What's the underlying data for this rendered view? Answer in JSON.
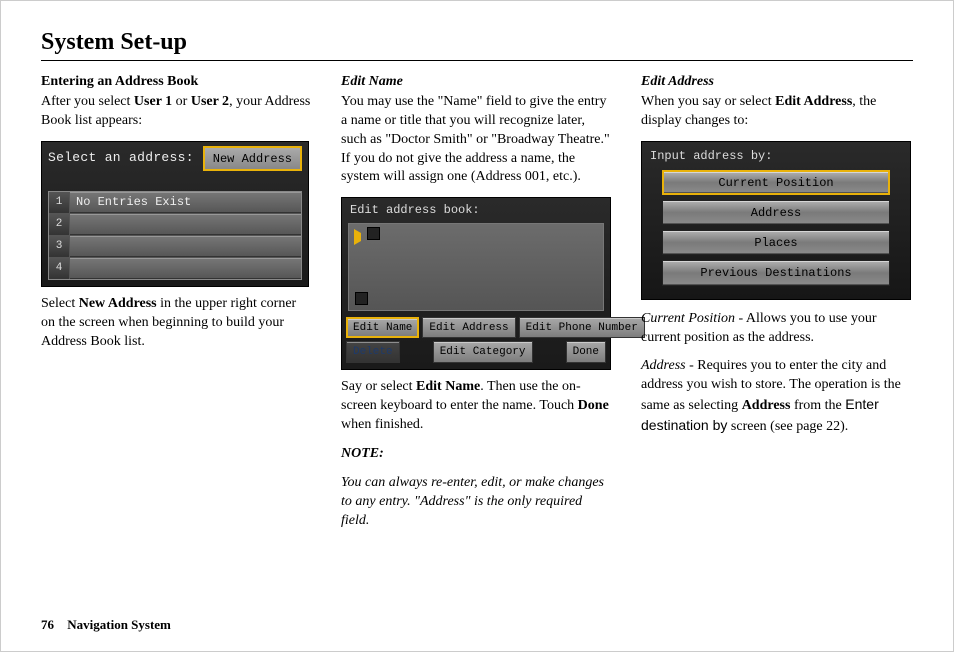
{
  "page_title": "System Set-up",
  "footer": {
    "page_number": "76",
    "title": "Navigation System"
  },
  "col1": {
    "heading": "Entering an Address Book",
    "intro_a": "After you select ",
    "user1": "User 1",
    "intro_b": " or ",
    "user2": "User 2",
    "intro_c": ", your Address Book list appears:",
    "after_a": "Select ",
    "after_bold": "New Address",
    "after_b": " in the upper right corner on the screen when beginning to build your Address Book list."
  },
  "ss1": {
    "title": "Select an address:",
    "new_btn": "New Address",
    "rows": [
      "1",
      "2",
      "3",
      "4"
    ],
    "no_entries": "No Entries Exist"
  },
  "col2": {
    "heading": "Edit Name",
    "body": "You may use the \"Name\" field to give the entry a name or title that you will recognize later, such as \"Doctor Smith\" or \"Broadway Theatre.\" If you do not give the address a name, the system will assign one (Address 001, etc.).",
    "after_a": "Say or select ",
    "after_bold": "Edit Name",
    "after_b": ". Then use the on-screen keyboard to enter the name. Touch ",
    "after_done": "Done",
    "after_c": " when finished.",
    "note_head": "NOTE:",
    "note_body": "You can always re-enter, edit, or make changes to any entry. \"Address\" is the only required field."
  },
  "ss2": {
    "title": "Edit address book:",
    "btn_edit_name": "Edit Name",
    "btn_edit_address": "Edit Address",
    "btn_edit_phone": "Edit Phone Number",
    "btn_delete": "Delete",
    "btn_edit_category": "Edit Category",
    "btn_done": "Done"
  },
  "col3": {
    "heading": "Edit Address",
    "intro_a": "When you say or select ",
    "intro_bold": "Edit Address",
    "intro_b": ", the display changes to:",
    "cp_label": "Current Position",
    "cp_rest": " - Allows you to use your current position as the address.",
    "addr_label": "Address",
    "addr_a": " - Requires you to enter the city and address you wish to store. The operation is the same as selecting ",
    "addr_bold": "Address",
    "addr_b": " from the ",
    "addr_sans": "Enter destination by",
    "addr_c": " screen (see page 22)."
  },
  "ss3": {
    "title": "Input address by:",
    "opt_current": "Current Position",
    "opt_address": "Address",
    "opt_places": "Places",
    "opt_prev": "Previous Destinations"
  }
}
